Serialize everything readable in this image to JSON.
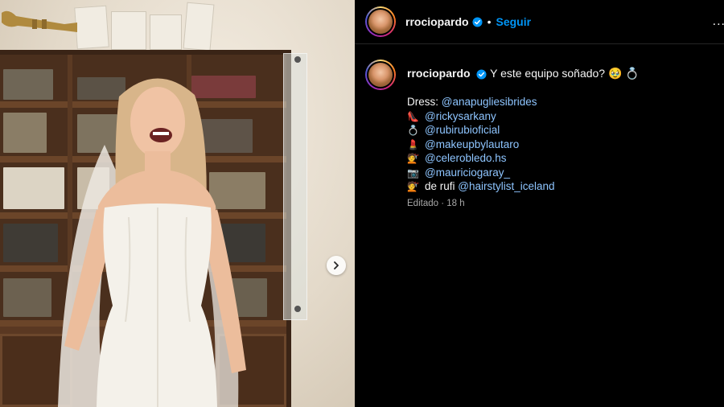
{
  "post": {
    "username": "rrociopardo",
    "follow_label": "Seguir",
    "separator": "•",
    "more_label": "..."
  },
  "caption": {
    "username": "rrociopardo",
    "text": "Y este equipo soñado? 🥹 💍",
    "lines": [
      {
        "prefix": "Dress: ",
        "emoji": "",
        "mention": "@anapugliesibrides"
      },
      {
        "prefix": "",
        "emoji": "👠",
        "mention": "@rickysarkany"
      },
      {
        "prefix": "",
        "emoji": "💍",
        "mention": "@rubirubioficial"
      },
      {
        "prefix": "",
        "emoji": "💄",
        "mention": "@makeupbylautaro"
      },
      {
        "prefix": "",
        "emoji": "💇",
        "mention": "@celerobledo.hs"
      },
      {
        "prefix": "",
        "emoji": "📷",
        "mention": "@mauriciogaray_"
      },
      {
        "prefix": "de rufi ",
        "emoji": "💇",
        "mention": "@hairstylist_iceland"
      }
    ],
    "edited": "Editado · 18 h"
  },
  "colors": {
    "accent": "#0095f6",
    "mention": "#8ec5ff",
    "background": "#000000",
    "secondary_text": "#a8a8a8"
  },
  "icons": {
    "verified": "verified-badge-icon",
    "next": "chevron-right-icon",
    "more": "more-options-icon"
  }
}
